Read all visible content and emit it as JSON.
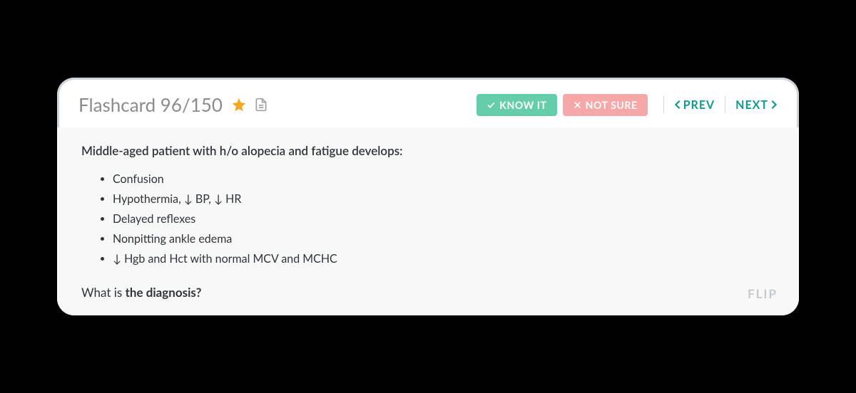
{
  "header": {
    "title": "Flashcard 96/150",
    "know_label": "KNOW IT",
    "notsure_label": "NOT SURE",
    "prev_label": "PREV",
    "next_label": "NEXT"
  },
  "card": {
    "lead": "Middle-aged patient with h/o alopecia and fatigue develops:",
    "bullets": [
      "Confusion",
      "Hypothermia, ↓ BP, ↓ HR",
      "Delayed reflexes",
      "Nonpitting ankle edema",
      "↓ Hgb and Hct with normal MCV and MCHC"
    ],
    "question_prefix": "What is ",
    "question_bold": "the diagnosis?",
    "flip_label": "FLIP"
  },
  "colors": {
    "accent": "#0d9b8c",
    "know": "#66cdaa",
    "notsure": "#f6a8a8",
    "star": "#f5a623"
  }
}
